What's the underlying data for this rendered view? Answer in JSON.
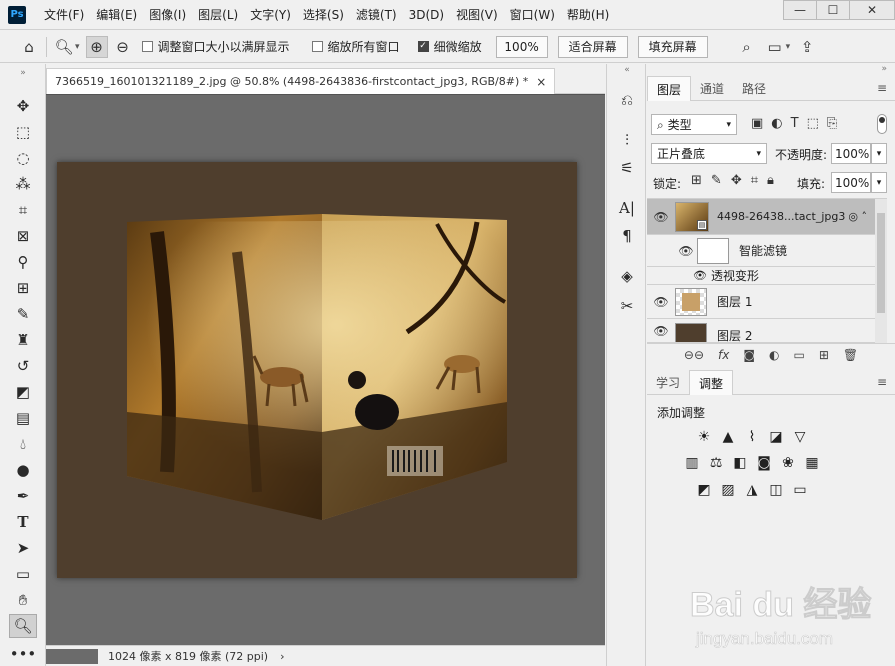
{
  "app": {
    "logo": "Ps",
    "menu": [
      "文件(F)",
      "编辑(E)",
      "图像(I)",
      "图层(L)",
      "文字(Y)",
      "选择(S)",
      "滤镜(T)",
      "3D(D)",
      "视图(V)",
      "窗口(W)",
      "帮助(H)"
    ],
    "window_buttons": [
      "—",
      "☐",
      "✕"
    ]
  },
  "options": {
    "resize_windows_label": "调整窗口大小以满屏显示",
    "zoom_all_label": "缩放所有窗口",
    "scrubby_zoom_label": "细微缩放",
    "scrubby_checked": true,
    "zoom_value": "100%",
    "fit_screen": "适合屏幕",
    "fill_screen": "填充屏幕"
  },
  "document": {
    "tab_title": "7366519_160101321189_2.jpg @ 50.8% (4498-2643836-firstcontact_jpg3, RGB/8#) *",
    "tab_close": "×",
    "status_text": "1024 像素 x 819 像素 (72 ppi)",
    "status_arrow": "›"
  },
  "layers_panel": {
    "tabs": [
      "图层",
      "通道",
      "路径"
    ],
    "filter_kind": "类型",
    "blend_mode": "正片叠底",
    "opacity_label": "不透明度:",
    "opacity_value": "100%",
    "lock_label": "锁定:",
    "fill_label": "填充:",
    "fill_value": "100%",
    "layers": [
      {
        "name": "4498-26438...tact_jpg3",
        "selected": true
      },
      {
        "name": "智能滤镜"
      },
      {
        "name": "透视变形"
      },
      {
        "name": "图层 1"
      },
      {
        "name": "图层 2"
      }
    ]
  },
  "adjust_panel": {
    "tabs": [
      "学习",
      "调整"
    ],
    "title": "添加调整"
  },
  "watermark": {
    "brand": "Bai du 经验",
    "url": "jingyan.baidu.com"
  },
  "colors": {
    "canvas_bg": "#4f3e2d",
    "workspace": "#6b6b6b",
    "panel": "#f0f0f0",
    "selected_layer": "#bdbdbd"
  }
}
